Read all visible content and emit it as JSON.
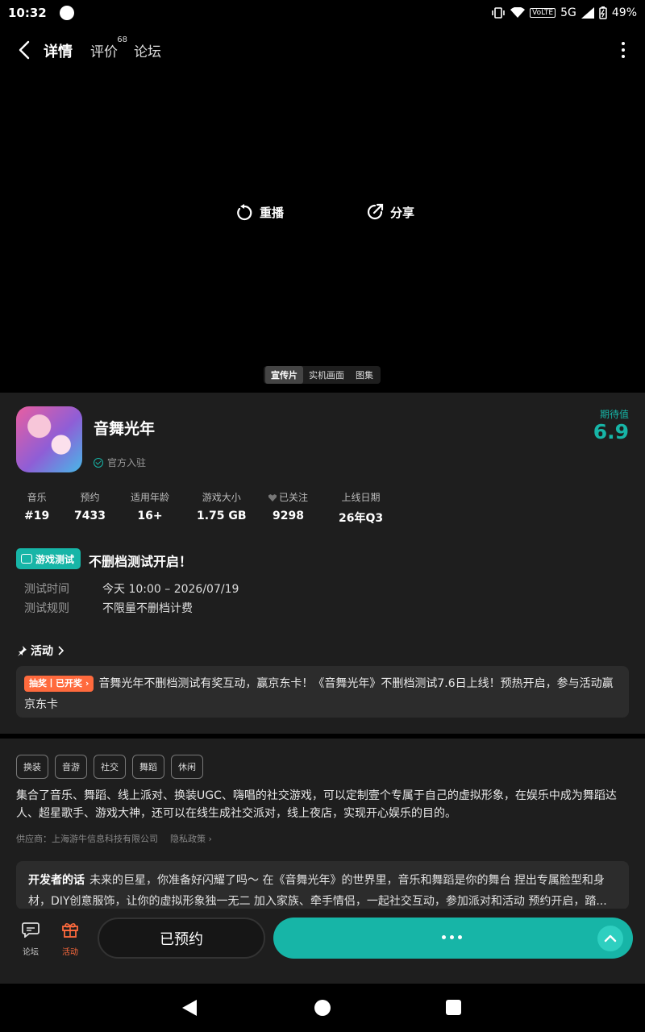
{
  "status": {
    "time": "10:32",
    "network": "5G",
    "volte": "VoLTE",
    "battery": "49%"
  },
  "nav": {
    "tab_detail": "详情",
    "tab_reviews": "评价",
    "reviews_count": "68",
    "tab_forum": "论坛"
  },
  "video": {
    "replay": "重播",
    "share": "分享",
    "media_tabs": [
      "宣传片",
      "实机画面",
      "图集"
    ]
  },
  "app": {
    "name": "音舞光年",
    "official": "官方入驻",
    "expect_label": "期待值",
    "expect_value": "6.9"
  },
  "stats": [
    {
      "key": "音乐",
      "value": "#19"
    },
    {
      "key": "预约",
      "value": "7433"
    },
    {
      "key": "适用年龄",
      "value": "16+"
    },
    {
      "key": "游戏大小",
      "value": "1.75 GB"
    },
    {
      "key": "已关注",
      "value": "9298"
    },
    {
      "key": "上线日期",
      "value": "26年Q3"
    }
  ],
  "test": {
    "badge": "游戏测试",
    "title": "不删档测试开启！",
    "time_label": "测试时间",
    "time_value": "今天 10:00 – 2026/07/19",
    "rule_label": "测试规则",
    "rule_value": "不限量不删档计费"
  },
  "activity": {
    "header": "活动",
    "badge": "抽奖丨已开奖",
    "text": "音舞光年不删档测试有奖互动，赢京东卡！《音舞光年》不删档测试7.6日上线！预热开启，参与活动赢京东卡"
  },
  "tags": [
    "换装",
    "音游",
    "社交",
    "舞蹈",
    "休闲"
  ],
  "description": "集合了音乐、舞蹈、线上派对、换装UGC、嗨唱的社交游戏，可以定制壹个专属于自己的虚拟形象，在娱乐中成为舞蹈达人、超星歌手、游戏大神，还可以在线生成社交派对，线上夜店，实现开心娱乐的目的。",
  "supplier": "供应商：上海游牛信息科技有限公司",
  "privacy": "隐私政策",
  "developer": {
    "label": "开发者的话",
    "text": "未来的巨星，你准备好闪耀了吗～ 在《音舞光年》的世界里，音乐和舞蹈是你的舞台 捏出专属脸型和身材，DIY创意服饰，让你的虚拟形象独一无二 加入家族、牵手情侣，一起社交互动，参加派对和活动 预约开启，踏..."
  },
  "bottom": {
    "forum": "论坛",
    "activity": "活动",
    "reserved": "已预约"
  },
  "colors": {
    "accent": "#17b5a7",
    "orange": "#ff6a3d",
    "panel": "#1e1e1e"
  }
}
